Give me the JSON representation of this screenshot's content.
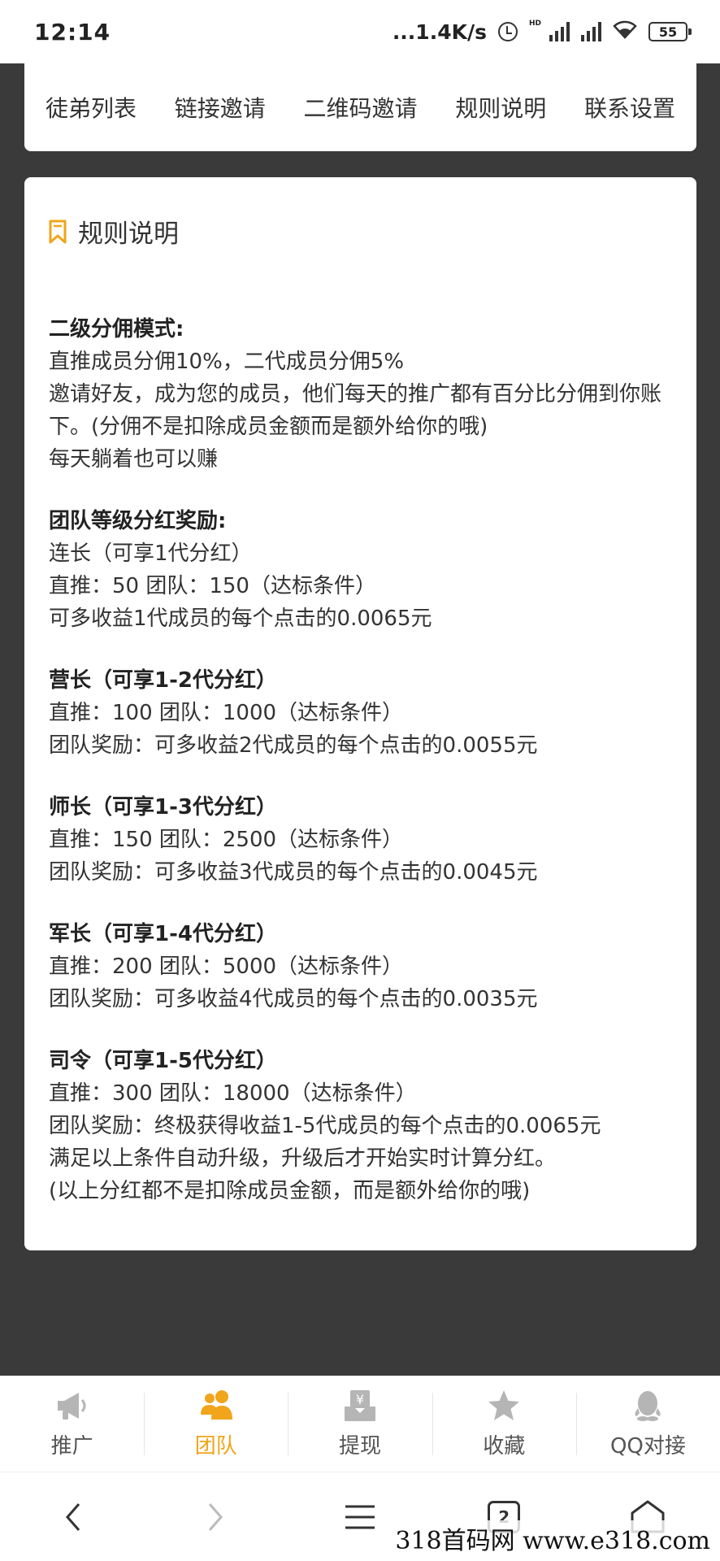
{
  "status": {
    "time": "12:14",
    "network": "...1.4K/s",
    "hd": "HD",
    "battery": "55"
  },
  "tabs": [
    {
      "label": "徒弟列表"
    },
    {
      "label": "链接邀请"
    },
    {
      "label": "二维码邀请"
    },
    {
      "label": "规则说明"
    },
    {
      "label": "联系设置"
    }
  ],
  "rules": {
    "title": "规则说明",
    "sections": [
      {
        "title": "二级分佣模式:",
        "lines": [
          "直推成员分佣10%，二代成员分佣5%",
          "邀请好友，成为您的成员，他们每天的推广都有百分比分佣到你账下。(分佣不是扣除成员金额而是额外给你的哦)",
          "每天躺着也可以赚"
        ]
      },
      {
        "title": "团队等级分红奖励:",
        "lines": [
          "连长（可享1代分红）",
          "直推：50 团队：150（达标条件）",
          "可多收益1代成员的每个点击的0.0065元"
        ]
      },
      {
        "title": "营长（可享1-2代分红）",
        "lines": [
          "直推：100 团队：1000（达标条件）",
          "团队奖励：可多收益2代成员的每个点击的0.0055元"
        ]
      },
      {
        "title": "师长（可享1-3代分红）",
        "lines": [
          "直推：150 团队：2500（达标条件）",
          "团队奖励：可多收益3代成员的每个点击的0.0045元"
        ]
      },
      {
        "title": "军长（可享1-4代分红）",
        "lines": [
          "直推：200 团队：5000（达标条件）",
          "团队奖励：可多收益4代成员的每个点击的0.0035元"
        ]
      },
      {
        "title": "司令（可享1-5代分红）",
        "lines": [
          "直推：300 团队：18000（达标条件）",
          "团队奖励：终极获得收益1-5代成员的每个点击的0.0065元",
          "满足以上条件自动升级，升级后才开始实时计算分红。",
          "(以上分红都不是扣除成员金额，而是额外给你的哦)"
        ]
      }
    ]
  },
  "nav": [
    {
      "label": "推广",
      "icon": "megaphone-icon"
    },
    {
      "label": "团队",
      "icon": "team-icon",
      "active": true
    },
    {
      "label": "提现",
      "icon": "withdraw-icon"
    },
    {
      "label": "收藏",
      "icon": "star-icon"
    },
    {
      "label": "QQ对接",
      "icon": "qq-icon"
    }
  ],
  "browser": {
    "tab_count": "2"
  },
  "watermark": "318首码网 www.e318.com",
  "colors": {
    "accent": "#f0a51a",
    "background": "#3a3a3a",
    "icon_gray": "#b5b5b5"
  }
}
